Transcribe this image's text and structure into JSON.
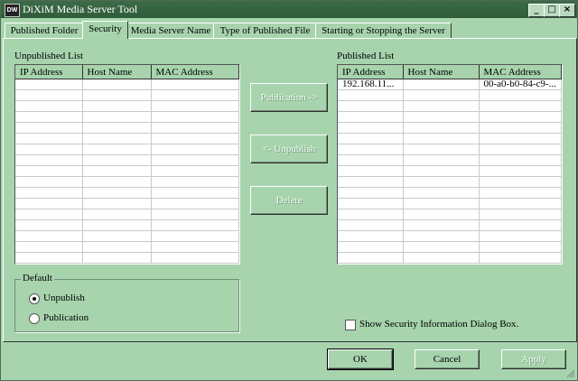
{
  "window": {
    "title": "DiXiM Media Server Tool",
    "icon_text": "DW"
  },
  "tabs": [
    {
      "label": "Published Folder"
    },
    {
      "label": "Security",
      "active": true
    },
    {
      "label": "Media Server Name"
    },
    {
      "label": "Type of Published File"
    },
    {
      "label": "Starting or Stopping the Server"
    }
  ],
  "unpublished": {
    "title": "Unpublished  List",
    "columns": [
      "IP Address",
      "Host Name",
      "MAC Address"
    ],
    "rows": []
  },
  "published": {
    "title": "Published List",
    "columns": [
      "IP Address",
      "Host Name",
      "MAC Address"
    ],
    "rows": [
      {
        "ip": "192.168.11...",
        "host": "",
        "mac": "00-a0-b0-84-c9-..."
      }
    ]
  },
  "actions": {
    "publication": "Publication ->",
    "unpublish": "<- Unpublish",
    "delete": "Delete"
  },
  "default_group": {
    "title": "Default",
    "options": [
      {
        "label": "Unpublish",
        "selected": true
      },
      {
        "label": "Publication",
        "selected": false
      }
    ]
  },
  "show_dialog": {
    "label": "Show Security Information Dialog Box.",
    "checked": false
  },
  "footer": {
    "ok": "OK",
    "cancel": "Cancel",
    "apply": "Apply"
  },
  "colors": {
    "window_bg": "#a7d4ad",
    "titlebar": "#2f5d39"
  }
}
